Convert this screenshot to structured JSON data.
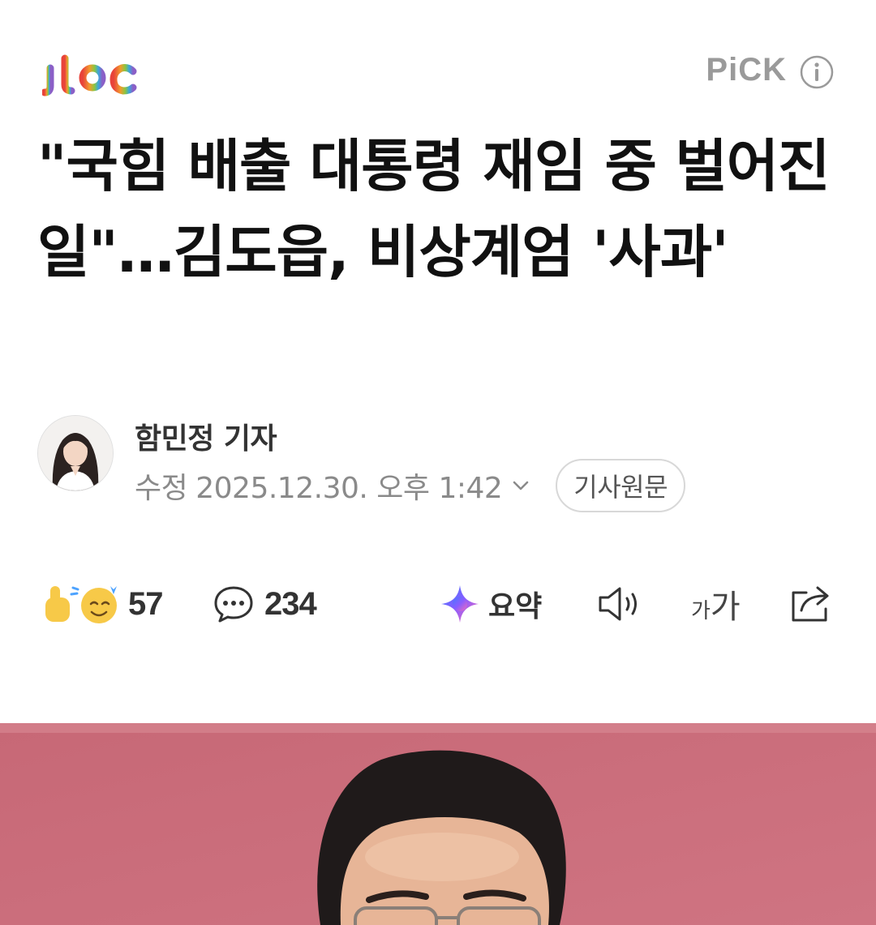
{
  "header": {
    "logo_text": "jtbc",
    "pick_label": "PiCK",
    "info_icon": "info-icon"
  },
  "article": {
    "headline": "\"국힘 배출 대통령 재임 중 벌어진 일\"…김도읍, 비상계엄 '사과'",
    "author": "함민정 기자",
    "modified_label": "수정",
    "modified_datetime": "2025.12.30. 오후 1:42",
    "original_button": "기사원문"
  },
  "actions": {
    "reactions_count": "57",
    "comments_count": "234",
    "summary_label": "요약",
    "font_size_label_small": "가",
    "font_size_label_large": "가",
    "icons": [
      "reaction-emoji-icon",
      "comment-icon",
      "summary-sparkle-icon",
      "speaker-icon",
      "share-icon"
    ]
  },
  "colors": {
    "text_primary": "#111111",
    "text_secondary": "#8a8a8a",
    "pick_gray": "#9a9a9a",
    "photo_background": "#c86a78"
  }
}
